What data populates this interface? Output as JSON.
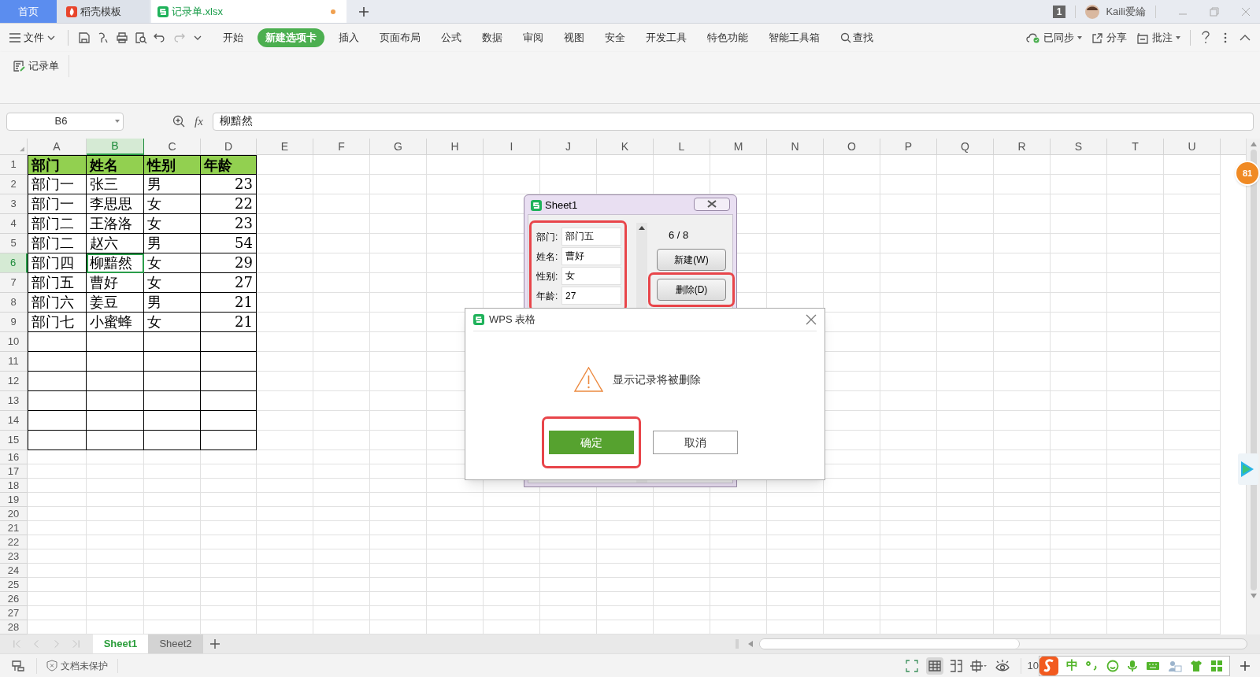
{
  "tabs": [
    {
      "label": "首页",
      "kind": "home",
      "selected": false
    },
    {
      "label": "稻壳模板",
      "kind": "docer",
      "selected": false
    },
    {
      "label": "记录单.xlsx",
      "kind": "sheet",
      "selected": true,
      "unsaved": true
    }
  ],
  "account": {
    "badge": "1",
    "user": "Kaili爱綸"
  },
  "menu": {
    "file": "文件",
    "tabs": [
      {
        "label": "开始",
        "selected": false
      },
      {
        "label": "新建选项卡",
        "selected": true
      },
      {
        "label": "插入",
        "selected": false
      },
      {
        "label": "页面布局",
        "selected": false
      },
      {
        "label": "公式",
        "selected": false
      },
      {
        "label": "数据",
        "selected": false
      },
      {
        "label": "审阅",
        "selected": false
      },
      {
        "label": "视图",
        "selected": false
      },
      {
        "label": "安全",
        "selected": false
      },
      {
        "label": "开发工具",
        "selected": false
      },
      {
        "label": "特色功能",
        "selected": false
      },
      {
        "label": "智能工具箱",
        "selected": false
      }
    ],
    "search": "查找",
    "sync": "已同步",
    "share": "分享",
    "comment": "批注"
  },
  "ribbon": {
    "button": "记录单"
  },
  "formula_bar": {
    "name_box": "B6",
    "fx": "fx",
    "value": "柳黯然"
  },
  "sheet": {
    "columns": [
      {
        "label": "A",
        "selected": false
      },
      {
        "label": "B",
        "selected": true
      },
      {
        "label": "C",
        "selected": false
      },
      {
        "label": "D",
        "selected": false
      },
      {
        "label": "E",
        "selected": false
      },
      {
        "label": "F",
        "selected": false
      },
      {
        "label": "G",
        "selected": false
      },
      {
        "label": "H",
        "selected": false
      },
      {
        "label": "I",
        "selected": false
      },
      {
        "label": "J",
        "selected": false
      },
      {
        "label": "K",
        "selected": false
      },
      {
        "label": "L",
        "selected": false
      },
      {
        "label": "M",
        "selected": false
      },
      {
        "label": "N",
        "selected": false
      },
      {
        "label": "O",
        "selected": false
      },
      {
        "label": "P",
        "selected": false
      },
      {
        "label": "Q",
        "selected": false
      },
      {
        "label": "R",
        "selected": false
      },
      {
        "label": "S",
        "selected": false
      },
      {
        "label": "T",
        "selected": false
      },
      {
        "label": "U",
        "selected": false
      }
    ],
    "rows": [
      {
        "number": "1",
        "kind": "header",
        "selected": false,
        "cells": [
          {
            "text": "部门",
            "kind": "text",
            "selected": false
          },
          {
            "text": "姓名",
            "kind": "text",
            "selected": false
          },
          {
            "text": "性别",
            "kind": "text",
            "selected": false
          },
          {
            "text": "年龄",
            "kind": "text",
            "selected": false
          }
        ]
      },
      {
        "number": "2",
        "kind": "record",
        "selected": false,
        "cells": [
          {
            "text": "部门一",
            "kind": "text",
            "selected": false
          },
          {
            "text": "张三",
            "kind": "text",
            "selected": false
          },
          {
            "text": "男",
            "kind": "text",
            "selected": false
          },
          {
            "text": "23",
            "kind": "number",
            "selected": false
          }
        ]
      },
      {
        "number": "3",
        "kind": "record",
        "selected": false,
        "cells": [
          {
            "text": "部门一",
            "kind": "text",
            "selected": false
          },
          {
            "text": "李思思",
            "kind": "text",
            "selected": false
          },
          {
            "text": "女",
            "kind": "text",
            "selected": false
          },
          {
            "text": "22",
            "kind": "number",
            "selected": false
          }
        ]
      },
      {
        "number": "4",
        "kind": "record",
        "selected": false,
        "cells": [
          {
            "text": "部门二",
            "kind": "text",
            "selected": false
          },
          {
            "text": "王洛洛",
            "kind": "text",
            "selected": false
          },
          {
            "text": "女",
            "kind": "text",
            "selected": false
          },
          {
            "text": "23",
            "kind": "number",
            "selected": false
          }
        ]
      },
      {
        "number": "5",
        "kind": "record",
        "selected": false,
        "cells": [
          {
            "text": "部门二",
            "kind": "text",
            "selected": false
          },
          {
            "text": "赵六",
            "kind": "text",
            "selected": false
          },
          {
            "text": "男",
            "kind": "text",
            "selected": false
          },
          {
            "text": "54",
            "kind": "number",
            "selected": false
          }
        ]
      },
      {
        "number": "6",
        "kind": "record",
        "selected": true,
        "cells": [
          {
            "text": "部门四",
            "kind": "text",
            "selected": false
          },
          {
            "text": "柳黯然",
            "kind": "text",
            "selected": true
          },
          {
            "text": "女",
            "kind": "text",
            "selected": false
          },
          {
            "text": "29",
            "kind": "number",
            "selected": false
          }
        ]
      },
      {
        "number": "7",
        "kind": "record",
        "selected": false,
        "cells": [
          {
            "text": "部门五",
            "kind": "text",
            "selected": false
          },
          {
            "text": "曹好",
            "kind": "text",
            "selected": false
          },
          {
            "text": "女",
            "kind": "text",
            "selected": false
          },
          {
            "text": "27",
            "kind": "number",
            "selected": false
          }
        ]
      },
      {
        "number": "8",
        "kind": "record",
        "selected": false,
        "cells": [
          {
            "text": "部门六",
            "kind": "text",
            "selected": false
          },
          {
            "text": "姜豆",
            "kind": "text",
            "selected": false
          },
          {
            "text": "男",
            "kind": "text",
            "selected": false
          },
          {
            "text": "21",
            "kind": "number",
            "selected": false
          }
        ]
      },
      {
        "number": "9",
        "kind": "record",
        "selected": false,
        "cells": [
          {
            "text": "部门七",
            "kind": "text",
            "selected": false
          },
          {
            "text": "小蜜蜂",
            "kind": "text",
            "selected": false
          },
          {
            "text": "女",
            "kind": "text",
            "selected": false
          },
          {
            "text": "21",
            "kind": "number",
            "selected": false
          }
        ]
      },
      {
        "number": "10",
        "kind": "blank",
        "selected": false
      },
      {
        "number": "11",
        "kind": "blank",
        "selected": false
      },
      {
        "number": "12",
        "kind": "blank",
        "selected": false
      },
      {
        "number": "13",
        "kind": "blank",
        "selected": false
      },
      {
        "number": "14",
        "kind": "blank",
        "selected": false
      },
      {
        "number": "15",
        "kind": "blank",
        "selected": false
      },
      {
        "number": "16",
        "kind": "plain",
        "selected": false
      },
      {
        "number": "17",
        "kind": "plain",
        "selected": false
      },
      {
        "number": "18",
        "kind": "plain",
        "selected": false
      },
      {
        "number": "19",
        "kind": "plain",
        "selected": false
      },
      {
        "number": "20",
        "kind": "plain",
        "selected": false
      },
      {
        "number": "21",
        "kind": "plain",
        "selected": false
      },
      {
        "number": "22",
        "kind": "plain",
        "selected": false
      },
      {
        "number": "23",
        "kind": "plain",
        "selected": false
      },
      {
        "number": "24",
        "kind": "plain",
        "selected": false
      },
      {
        "number": "25",
        "kind": "plain",
        "selected": false
      },
      {
        "number": "26",
        "kind": "plain",
        "selected": false
      },
      {
        "number": "27",
        "kind": "plain",
        "selected": false
      },
      {
        "number": "28",
        "kind": "plain",
        "selected": false
      }
    ]
  },
  "side_badge": "81",
  "sheet_tabs": [
    {
      "label": "Sheet1",
      "selected": true
    },
    {
      "label": "Sheet2",
      "selected": false
    }
  ],
  "status_bar": {
    "protection": "文档未保护",
    "zoom": "10",
    "ime": "中"
  },
  "record_dialog": {
    "title": "Sheet1",
    "highlighted": true,
    "fields": [
      {
        "label": "部门:",
        "value": "部门五"
      },
      {
        "label": "姓名:",
        "value": "曹好"
      },
      {
        "label": "性别:",
        "value": "女"
      },
      {
        "label": "年龄:",
        "value": "27"
      }
    ],
    "counter": "6 / 8",
    "buttons": [
      {
        "label": "新建(W)",
        "highlighted": false
      },
      {
        "label": "删除(D)",
        "highlighted": true
      }
    ]
  },
  "message_box": {
    "title": "WPS 表格",
    "message": "显示记录将被删除",
    "buttons": [
      {
        "label": "确定",
        "kind": "primary",
        "highlighted": true
      },
      {
        "label": "取消",
        "kind": "secondary",
        "highlighted": false
      }
    ]
  }
}
